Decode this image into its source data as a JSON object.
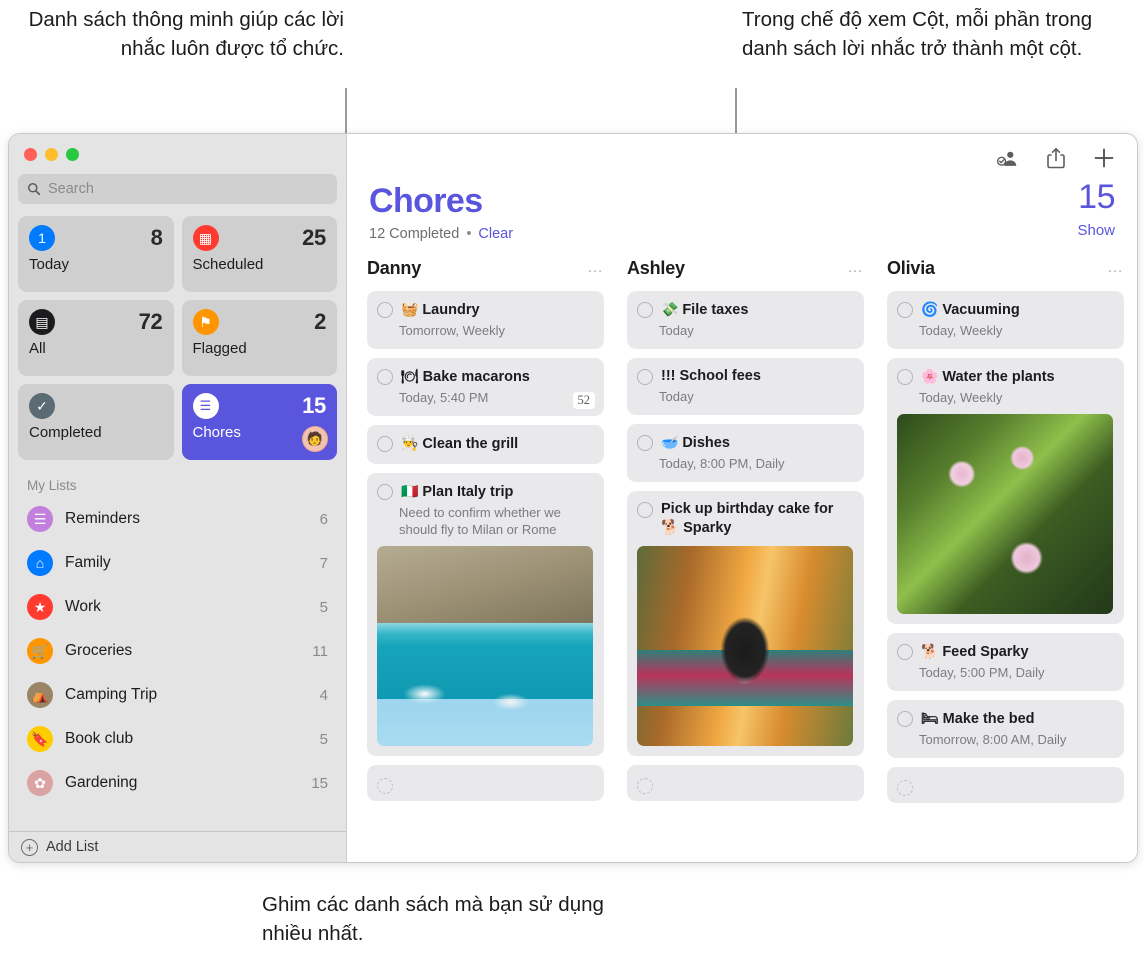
{
  "annotations": {
    "top_left": "Danh sách thông minh giúp các lời nhắc luôn được tổ chức.",
    "top_right": "Trong chế độ xem Cột, mỗi phần trong danh sách lời nhắc trở thành một cột.",
    "bottom": "Ghim các danh sách mà bạn sử dụng nhiều nhất."
  },
  "sidebar": {
    "search": {
      "placeholder": "Search",
      "icon": "search-icon"
    },
    "smart_lists": [
      {
        "label": "Today",
        "count": "8",
        "icon": "calendar-day-icon",
        "color": "#007aff",
        "glyph": "1",
        "selected": false
      },
      {
        "label": "Scheduled",
        "count": "25",
        "icon": "calendar-icon",
        "color": "#ff3b30",
        "glyph": "▦",
        "selected": false
      },
      {
        "label": "All",
        "count": "72",
        "icon": "tray-icon",
        "color": "#1c1c1e",
        "glyph": "▤",
        "selected": false
      },
      {
        "label": "Flagged",
        "count": "2",
        "icon": "flag-icon",
        "color": "#ff9500",
        "glyph": "⚑",
        "selected": false
      },
      {
        "label": "Completed",
        "count": "",
        "icon": "checkmark-icon",
        "color": "#5b6b73",
        "glyph": "✓",
        "selected": false
      },
      {
        "label": "Chores",
        "count": "15",
        "icon": "list-icon",
        "color": "#ffffff",
        "glyph": "☰",
        "selected": true,
        "avatar": "shared-avatar"
      }
    ],
    "my_lists_title": "My Lists",
    "my_lists": [
      {
        "label": "Reminders",
        "count": "6",
        "icon": "list-icon",
        "color": "#c27fdd",
        "glyph": "☰"
      },
      {
        "label": "Family",
        "count": "7",
        "icon": "house-icon",
        "color": "#007aff",
        "glyph": "⌂"
      },
      {
        "label": "Work",
        "count": "5",
        "icon": "star-icon",
        "color": "#ff3b30",
        "glyph": "★"
      },
      {
        "label": "Groceries",
        "count": "11",
        "icon": "cart-icon",
        "color": "#ff9500",
        "glyph": "🛒"
      },
      {
        "label": "Camping Trip",
        "count": "4",
        "icon": "tent-icon",
        "color": "#9c8567",
        "glyph": "⛺"
      },
      {
        "label": "Book club",
        "count": "5",
        "icon": "bookmark-icon",
        "color": "#ffcc00",
        "glyph": "🔖"
      },
      {
        "label": "Gardening",
        "count": "15",
        "icon": "flower-icon",
        "color": "#d9a3a3",
        "glyph": "✿"
      }
    ],
    "add_list_label": "Add List"
  },
  "toolbar": {
    "share_people_icon": "add-person-icon",
    "share_icon": "share-icon",
    "add_icon": "plus-icon"
  },
  "header": {
    "title": "Chores",
    "completed_text": "12 Completed",
    "separator": "•",
    "clear_label": "Clear",
    "count": "15",
    "show_label": "Show",
    "accent_color": "#5a55dd"
  },
  "columns": [
    {
      "name": "Danny",
      "menu": "…",
      "tasks": [
        {
          "emoji": "🧺",
          "title": "Laundry",
          "sub": "Tomorrow, Weekly"
        },
        {
          "emoji": "🍽",
          "title": "Bake macarons",
          "sub": "Today, 5:40 PM",
          "badge": "52"
        },
        {
          "emoji": "👨‍🍳",
          "title": "Clean the grill",
          "sub": ""
        },
        {
          "emoji": "🇮🇹",
          "title": "Plan Italy trip",
          "sub": "Need to confirm whether we should fly to Milan or Rome",
          "photo": "italy-coast-photo"
        },
        {
          "emoji": "",
          "title": "",
          "sub": "",
          "empty": true
        }
      ]
    },
    {
      "name": "Ashley",
      "menu": "…",
      "tasks": [
        {
          "emoji": "💸",
          "title": "File taxes",
          "sub": "Today"
        },
        {
          "emoji": "",
          "title": "!!! School fees",
          "sub": "Today"
        },
        {
          "emoji": "🥣",
          "title": "Dishes",
          "sub": "Today, 8:00 PM, Daily"
        },
        {
          "emoji": "🐕",
          "title": "Pick up birthday cake for 🐕 Sparky",
          "sub": "",
          "photo": "dog-photo"
        },
        {
          "emoji": "",
          "title": "",
          "sub": "",
          "empty": true
        }
      ]
    },
    {
      "name": "Olivia",
      "menu": "…",
      "tasks": [
        {
          "emoji": "🌀",
          "title": "Vacuuming",
          "sub": "Today, Weekly"
        },
        {
          "emoji": "🌸",
          "title": "Water the plants",
          "sub": "Today, Weekly",
          "photo": "flowers-photo"
        },
        {
          "emoji": "🐕",
          "title": "Feed Sparky",
          "sub": "Today, 5:00 PM, Daily"
        },
        {
          "emoji": "🛏",
          "title": "Make the bed",
          "sub": "Tomorrow, 8:00 AM, Daily"
        },
        {
          "emoji": "",
          "title": "",
          "sub": "",
          "empty": true
        }
      ]
    }
  ]
}
